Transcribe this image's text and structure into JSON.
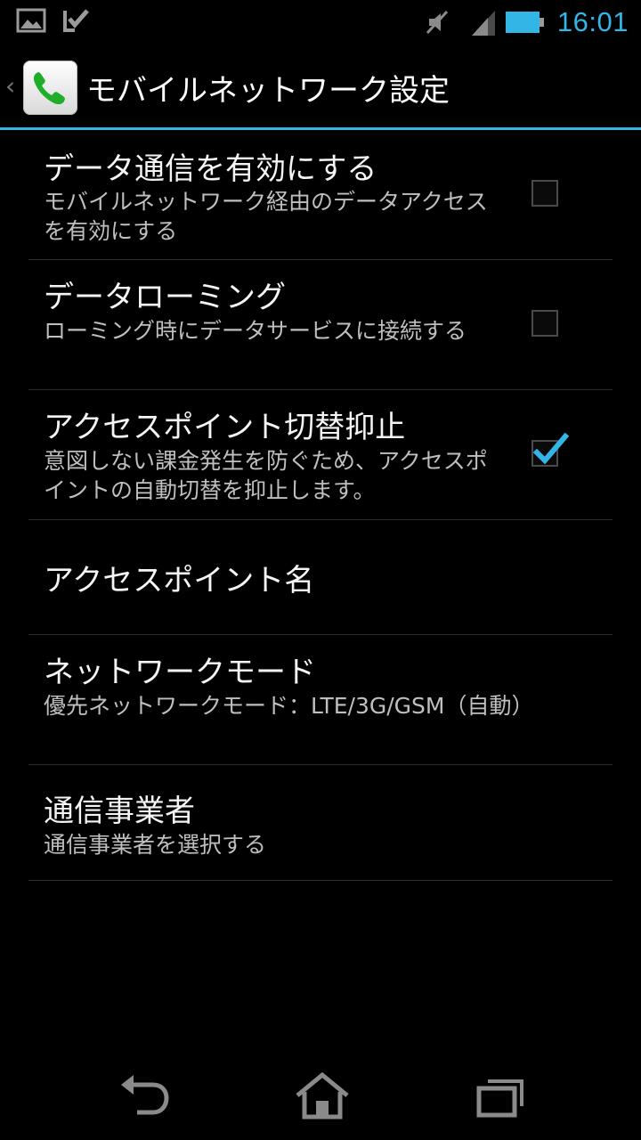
{
  "status_bar": {
    "time": "16:01",
    "icons": [
      "gallery-icon",
      "task-check-icon",
      "mute-icon",
      "signal-icon",
      "battery-icon"
    ],
    "accent_color": "#33b5e5"
  },
  "action_bar": {
    "title": "モバイルネットワーク設定",
    "up_caret": "‹",
    "app_icon": "phone-icon"
  },
  "preferences": [
    {
      "title": "データ通信を有効にする",
      "summary": "モバイルネットワーク経由のデータアクセスを有効にする",
      "checkbox": true,
      "checked": false
    },
    {
      "title": "データローミング",
      "summary": "ローミング時にデータサービスに接続する",
      "checkbox": true,
      "checked": false
    },
    {
      "title": "アクセスポイント切替抑止",
      "summary": "意図しない課金発生を防ぐため、アクセスポイントの自動切替を抑止します。",
      "checkbox": true,
      "checked": true
    },
    {
      "title": "アクセスポイント名",
      "summary": "",
      "checkbox": false,
      "checked": false
    },
    {
      "title": "ネットワークモード",
      "summary": "優先ネットワークモード：LTE/3G/GSM（自動）",
      "checkbox": false,
      "checked": false
    },
    {
      "title": "通信事業者",
      "summary": "通信事業者を選択する",
      "checkbox": false,
      "checked": false
    }
  ],
  "nav_bar": {
    "buttons": [
      "back-icon",
      "home-icon",
      "recent-apps-icon"
    ]
  }
}
